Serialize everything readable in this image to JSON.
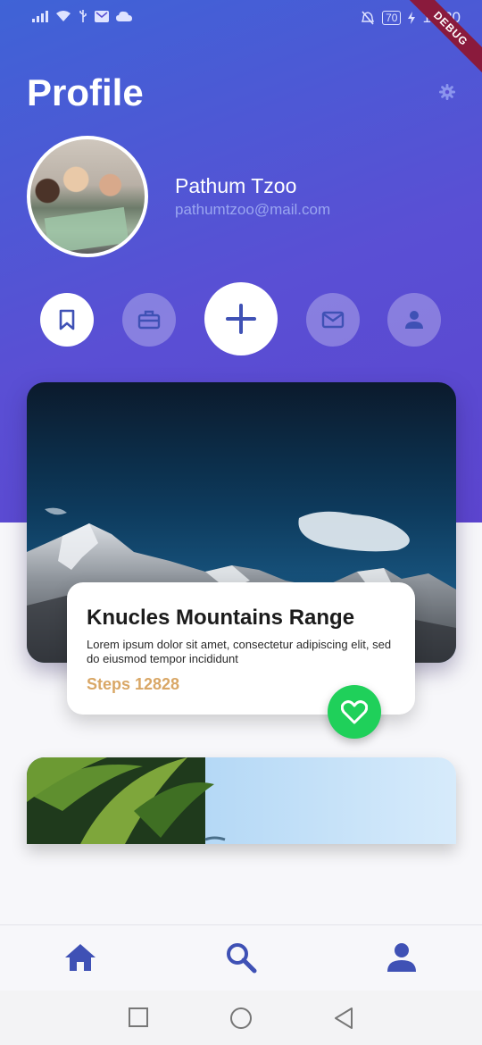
{
  "status_bar": {
    "time": "12:30",
    "battery": "70",
    "debug_label": "DEBUG"
  },
  "header": {
    "title": "Profile"
  },
  "profile": {
    "name": "Pathum Tzoo",
    "email": "pathumtzoo@mail.com"
  },
  "actions": [
    {
      "icon": "bookmark-icon"
    },
    {
      "icon": "briefcase-icon"
    },
    {
      "icon": "plus-icon"
    },
    {
      "icon": "mail-icon"
    },
    {
      "icon": "person-icon"
    }
  ],
  "featured": {
    "title": "Knucles Mountains Range",
    "description": "Lorem ipsum dolor sit amet, consectetur adipiscing elit, sed do eiusmod tempor incididunt",
    "steps": "Steps 12828"
  },
  "bottom_nav": [
    {
      "icon": "home-icon"
    },
    {
      "icon": "search-icon"
    },
    {
      "icon": "person-icon"
    }
  ],
  "colors": {
    "accent": "#3f51b5",
    "favorite": "#1fd05a",
    "steps": "#d9a766"
  }
}
